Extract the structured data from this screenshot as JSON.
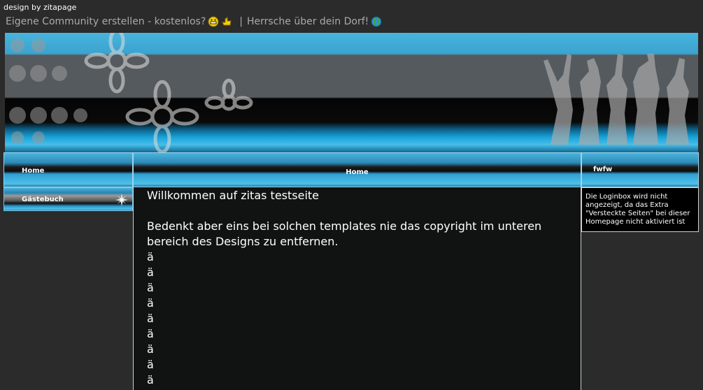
{
  "header": {
    "credit": "design by zitapage",
    "promo_link_1": "Eigene Community erstellen - kostenlos?",
    "separator": "|",
    "promo_link_2": "Herrsche über dein Dorf!"
  },
  "nav": {
    "left_home": "Home",
    "center_home": "Home",
    "right_title": "fwfw",
    "guestbook": "Gästebuch"
  },
  "content": {
    "welcome": "Willkommen auf zitas testseite",
    "notice": "Bedenkt aber eins bei solchen templates nie das copyright im unteren bereich des Designs zu entfernen.",
    "chars": [
      "ä",
      "ä",
      "ä",
      "ä",
      "ä",
      "ä",
      "ä",
      "ä",
      "ä"
    ]
  },
  "sidebar_right": {
    "info_text": "Die Loginbox wird nicht angezeigt, da das Extra \"Versteckte Seiten\" bei dieser Homepage nicht aktiviert ist"
  },
  "icons": [
    "grinning-face-icon",
    "thumbs-up-hand-icon",
    "globe-icon",
    "star-icon"
  ],
  "colors": {
    "background": "#2b2b2b",
    "accent_blue": "#3aa7d6",
    "content_bg": "#111212",
    "promo_text": "#aaaaaa"
  }
}
